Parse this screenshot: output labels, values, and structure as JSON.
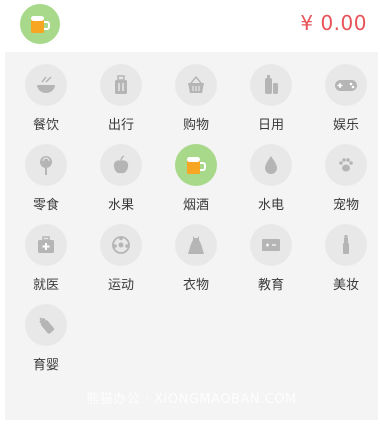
{
  "header": {
    "selected_icon": "beer-icon",
    "amount": "¥ 0.00"
  },
  "categories": [
    {
      "label": "餐饮",
      "icon": "bowl-icon",
      "selected": false
    },
    {
      "label": "出行",
      "icon": "luggage-icon",
      "selected": false
    },
    {
      "label": "购物",
      "icon": "basket-icon",
      "selected": false
    },
    {
      "label": "日用",
      "icon": "toiletry-icon",
      "selected": false
    },
    {
      "label": "娱乐",
      "icon": "gamepad-icon",
      "selected": false
    },
    {
      "label": "零食",
      "icon": "lollipop-icon",
      "selected": false
    },
    {
      "label": "水果",
      "icon": "apple-icon",
      "selected": false
    },
    {
      "label": "烟酒",
      "icon": "beer-icon",
      "selected": true
    },
    {
      "label": "水电",
      "icon": "water-drop-icon",
      "selected": false
    },
    {
      "label": "宠物",
      "icon": "paw-icon",
      "selected": false
    },
    {
      "label": "就医",
      "icon": "medical-kit-icon",
      "selected": false
    },
    {
      "label": "运动",
      "icon": "ball-icon",
      "selected": false
    },
    {
      "label": "衣物",
      "icon": "dress-icon",
      "selected": false
    },
    {
      "label": "教育",
      "icon": "blackboard-icon",
      "selected": false
    },
    {
      "label": "美妆",
      "icon": "cosmetics-icon",
      "selected": false
    },
    {
      "label": "育婴",
      "icon": "baby-bottle-icon",
      "selected": false
    }
  ],
  "watermark": "熊猫办公 · XIONGMAOBAN.COM",
  "colors": {
    "accent": "#a8d98a",
    "amount": "#e8535a",
    "icon_bg": "#e8e8e8",
    "icon_fg": "#b5b5b5"
  }
}
